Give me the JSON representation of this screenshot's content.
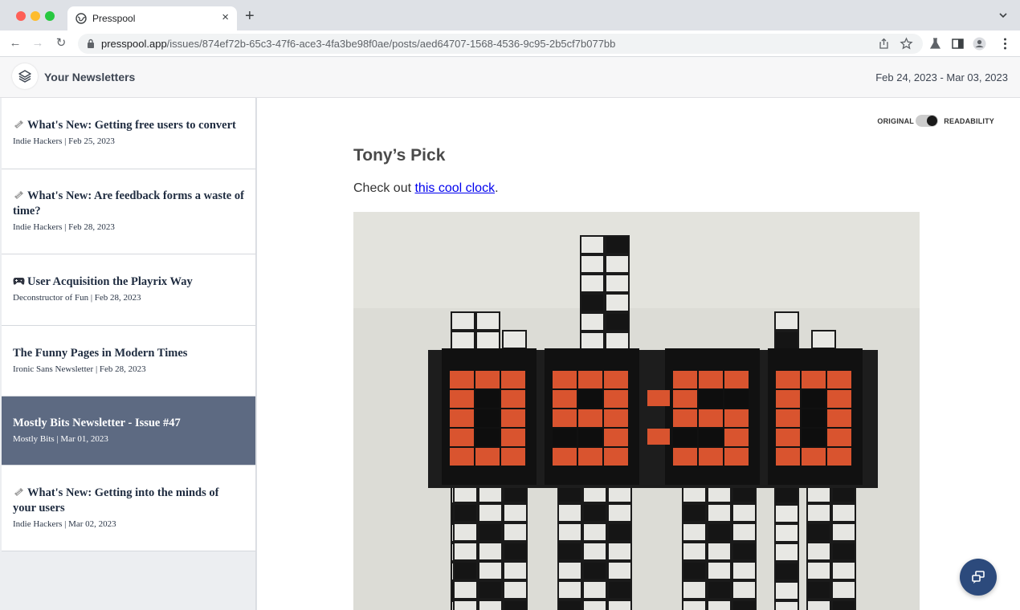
{
  "browser": {
    "tab_title": "Presspool",
    "url_host": "presspool.app",
    "url_path": "/issues/874ef72b-65c3-47f6-ace3-4fa3be98f0ae/posts/aed64707-1568-4536-9c95-2b5cf7b077bb"
  },
  "header": {
    "title": "Your Newsletters",
    "date_range": "Feb 24, 2023 - Mar 03, 2023"
  },
  "sidebar": {
    "items": [
      {
        "icon": "newspaper-icon",
        "title": "What's New: Getting free users to convert",
        "meta": "Indie Hackers | Feb 25, 2023",
        "selected": false
      },
      {
        "icon": "newspaper-icon",
        "title": "What's New: Are feedback forms a waste of time?",
        "meta": "Indie Hackers | Feb 28, 2023",
        "selected": false
      },
      {
        "icon": "game-controller-icon",
        "title": "User Acquisition the Playrix Way",
        "meta": "Deconstructor of Fun | Feb 28, 2023",
        "selected": false
      },
      {
        "icon": "",
        "title": "The Funny Pages in Modern Times",
        "meta": "Ironic Sans Newsletter | Feb 28, 2023",
        "selected": false
      },
      {
        "icon": "",
        "title": "Mostly Bits Newsletter - Issue #47",
        "meta": "Mostly Bits | Mar 01, 2023",
        "selected": true
      },
      {
        "icon": "newspaper-icon",
        "title": "What's New: Getting into the minds of your users",
        "meta": "Indie Hackers | Mar 02, 2023",
        "selected": false
      }
    ]
  },
  "view_toggle": {
    "left_label": "ORIGINAL",
    "right_label": "READABILITY",
    "active": "READABILITY"
  },
  "article": {
    "heading": "Tony’s Pick",
    "text_before": "Check out ",
    "link_text": "this cool clock",
    "text_after": ".",
    "image_icon": "pixel-clock-photo"
  },
  "colors": {
    "selected_bg": "#5d6a82",
    "accent_fab": "#2c4a7c",
    "clock_digit": "#d9542f"
  }
}
